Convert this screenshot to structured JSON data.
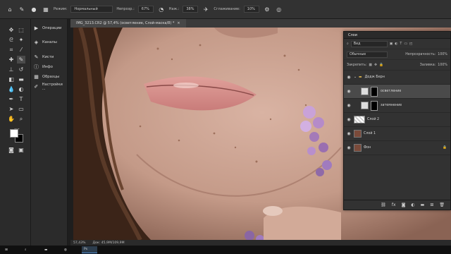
{
  "options_bar": {
    "mode_label": "Режим:",
    "mode_value": "Нормальный",
    "opacity_label": "Непрозр.:",
    "opacity_value": "67%",
    "flow_label": "Наж.:",
    "flow_value": "38%",
    "smoothing_label": "Сглаживание:",
    "smoothing_value": "10%",
    "icons": [
      "brush-icon",
      "brush-size-icon",
      "brush-panel-icon",
      "pressure-opacity-icon",
      "airbrush-icon",
      "settings-gear-icon",
      "pressure-size-icon"
    ]
  },
  "tools": {
    "icons": [
      "move-icon",
      "marquee-icon",
      "lasso-icon",
      "quick-select-icon",
      "crop-icon",
      "frame-icon",
      "eyedropper-icon",
      "ruler-icon",
      "healing-icon",
      "brush-icon",
      "clone-stamp-icon",
      "history-brush-icon",
      "eraser-icon",
      "gradient-icon",
      "blur-icon",
      "dodge-icon",
      "pen-icon",
      "type-icon",
      "path-select-icon",
      "rectangle-icon",
      "hand-icon",
      "zoom-icon",
      "more-icon",
      "edit-toolbar-icon",
      "quick-mask-icon",
      "screen-mode-icon"
    ]
  },
  "side_panels": {
    "items": [
      {
        "label": "Операции",
        "icon": "play-icon"
      },
      {
        "label": "Каналы",
        "icon": "channels-icon"
      },
      {
        "label": "Кисти",
        "icon": "brushes-icon"
      },
      {
        "label": "Инфо",
        "icon": "info-icon"
      },
      {
        "label": "Образцы",
        "icon": "swatches-icon"
      },
      {
        "label": "Настройки ...",
        "icon": "brush-settings-icon"
      }
    ]
  },
  "document": {
    "tab_title": "IMG_3213.CR2 @ 57,4% (осветление, Слой-маска/8) *",
    "zoom": "57,43%",
    "doc_size": "Док: 45,9M/109,9M"
  },
  "layers_panel": {
    "title": "Слои",
    "search_placeholder": "Вид",
    "blend_mode": "Обычные",
    "opacity_label": "Непрозрачность:",
    "opacity_value": "100%",
    "lock_label": "Закрепить:",
    "fill_label": "Заливка:",
    "fill_value": "100%",
    "layers": [
      {
        "name": "Додж Берн",
        "type": "group"
      },
      {
        "name": "осветление",
        "type": "adjustment",
        "selected": true
      },
      {
        "name": "затемнение",
        "type": "adjustment"
      },
      {
        "name": "Слой 2",
        "type": "pixel"
      },
      {
        "name": "Слой 1",
        "type": "pixel"
      },
      {
        "name": "Фон",
        "type": "background",
        "locked": true
      }
    ],
    "footer_icons": [
      "link-icon",
      "fx-icon",
      "mask-icon",
      "adjustment-icon",
      "folder-icon",
      "new-layer-icon",
      "trash-icon"
    ]
  },
  "taskbar": {
    "items": [
      {
        "label": "",
        "icon": "start-icon"
      },
      {
        "label": "",
        "icon": "search-icon"
      },
      {
        "label": "",
        "icon": "explorer-icon"
      },
      {
        "label": "",
        "icon": "chrome-icon"
      },
      {
        "label": "",
        "icon": "photoshop-icon"
      }
    ]
  },
  "colors": {
    "foreground": "#ffffff",
    "background": "#000000",
    "panel_bg": "#323232",
    "accent": "#4f8bd0"
  }
}
